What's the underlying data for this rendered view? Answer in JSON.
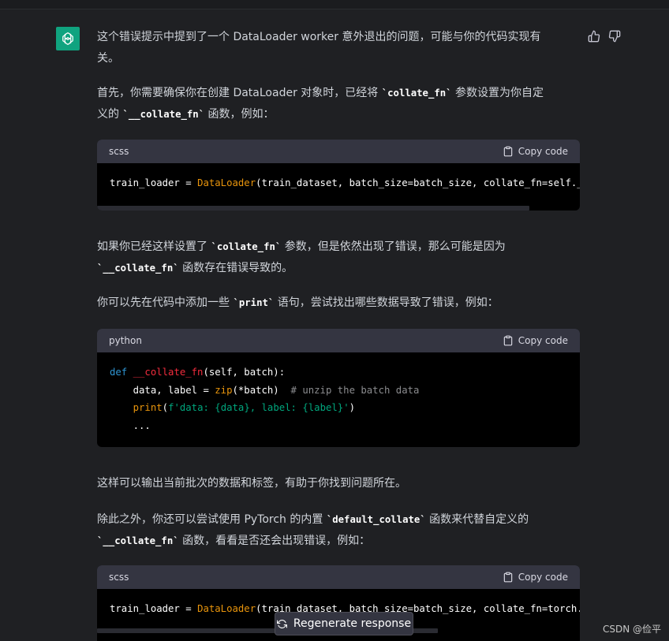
{
  "colors": {
    "background": "#1f2023",
    "avatar": "#10a37f",
    "code_header": "#343541",
    "code_body": "#000000"
  },
  "icons": {
    "avatar": "openai-logo-icon",
    "thumbs_up": "thumbs-up-icon",
    "thumbs_down": "thumbs-down-icon",
    "copy": "clipboard-icon",
    "regenerate": "refresh-icon"
  },
  "message": {
    "p1": {
      "line1": "这个错误提示中提到了一个 DataLoader worker 意外退出的问题，可能与你的代码实现有",
      "line2": "关。"
    },
    "p2": {
      "line1_a": "首先，你需要确保你在创建 DataLoader 对象时，已经将 ",
      "line1_code": "`collate_fn`",
      "line1_b": " 参数设置为你自定",
      "line2_a": "义的 ",
      "line2_code": "`__collate_fn`",
      "line2_b": " 函数，例如："
    },
    "code1": {
      "lang": "scss",
      "copy_label": "Copy code",
      "line1_a": "train_loader = ",
      "line1_fn": "DataLoader",
      "line1_b": "(train_dataset, batch_size=batch_size, collate_fn=self.__collate_fn)"
    },
    "p3": {
      "line1_a": "如果你已经这样设置了 ",
      "line1_code": "`collate_fn`",
      "line1_b": " 参数，但是依然出现了错误，那么可能是因为",
      "line2_code": "`__collate_fn`",
      "line2_b": " 函数存在错误导致的。"
    },
    "p4": {
      "line1_a": "你可以先在代码中添加一些 ",
      "line1_code": "`print`",
      "line1_b": " 语句，尝试找出哪些数据导致了错误，例如："
    },
    "code2": {
      "lang": "python",
      "copy_label": "Copy code",
      "l1_kw": "def",
      "l1_fn": "__collate_fn",
      "l1_rest": "(self, batch):",
      "l2_a": "    data, label = ",
      "l2_bi": "zip",
      "l2_b": "(*batch)  ",
      "l2_cm": "# unzip the batch data",
      "l3_indent": "    ",
      "l3_bi": "print",
      "l3_a": "(",
      "l3_str1": "f'data: ",
      "l3_v1": "{data}",
      "l3_str2": ", label: ",
      "l3_v2": "{label}",
      "l3_str3": "'",
      "l3_b": ")",
      "l4": "    ..."
    },
    "p5": {
      "line1": "这样可以输出当前批次的数据和标签，有助于你找到问题所在。"
    },
    "p6": {
      "line1_a": "除此之外，你还可以尝试使用 PyTorch 的内置 ",
      "line1_code": "`default_collate`",
      "line1_b": " 函数来代替自定义的",
      "line2_code": "`__collate_fn`",
      "line2_b": " 函数，看看是否还会出现错误，例如："
    },
    "code3": {
      "lang": "scss",
      "copy_label": "Copy code",
      "line1_a": "train_loader = ",
      "line1_fn": "DataLoader",
      "line1_b": "(train_dataset, batch_size=batch_size, collate_fn=torch.utils.data.default_collate)"
    }
  },
  "regenerate_label": "Regenerate response",
  "watermark": "CSDN @俭平"
}
